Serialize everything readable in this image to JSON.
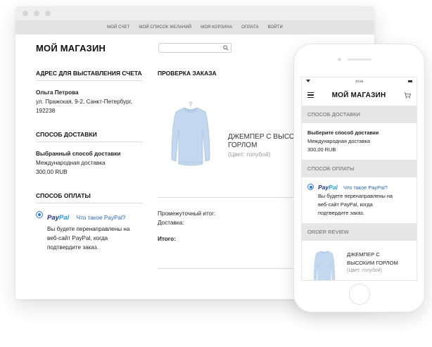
{
  "desktop": {
    "nav": [
      "МОЙ СЧЕТ",
      "МОЙ СПИСОК ЖЕЛАНИЙ",
      "МОЯ КОРЗИНА",
      "ОПЛАТА",
      "ВОЙТИ"
    ],
    "store_title": "МОЙ МАГАЗИН",
    "search": {
      "placeholder": ""
    },
    "billing": {
      "heading": "АДРЕС ДЛЯ ВЫСТАВЛЕНИЯ СЧЕТА",
      "name": "Ольга Петрова",
      "line1": "ул. Пражская, 9-2, Санкт-Петербург,",
      "line2": "192238"
    },
    "shipping": {
      "heading": "СПОСОБ ДОСТАВКИ",
      "label": "Выбранный способ доставки",
      "method": "Международная доставка",
      "price": "300,00 RUB"
    },
    "payment": {
      "heading": "СПОСОБ ОПЛАТЫ",
      "logo_part1": "Pay",
      "logo_part2": "Pal",
      "link": "Что такое PayPal?",
      "desc1": "Вы будете перенаправлены на",
      "desc2": "веб-сайт PayPal, когда",
      "desc3": "подтвердите заказ."
    },
    "review": {
      "heading": "ПРОВЕРКА ЗАКАЗА",
      "product_line1": "ДЖЕМПЕР С ВЫСОКИМ",
      "product_line2": "ГОРЛОМ",
      "product_color": "(Цвет: голубой)",
      "subtotal_label": "Промежуточный итог:",
      "delivery_label": "Доставка:",
      "total_label": "Итого:"
    }
  },
  "mobile": {
    "time": "10:26",
    "title": "МОЙ МАГАЗИН",
    "shipping": {
      "heading": "СПОСОБ ДОСТАВКИ",
      "label": "Выберите способ доставки",
      "method": "Международная доставка",
      "price": "300,00 RUB"
    },
    "payment": {
      "heading": "СПОСОБ ОПЛАТЫ",
      "logo_part1": "Pay",
      "logo_part2": "Pal",
      "link": "Что такое PayPal?",
      "desc1": "Вы будете перенаправлены на",
      "desc2": "веб-сайт PayPal, когда",
      "desc3": "подтвердите заказ."
    },
    "review": {
      "heading": "ORDER REVIEW",
      "product_line1": "ДЖЕМПЕР С",
      "product_line2": "ВЫСОКИМ ГОРЛОМ",
      "product_color": "(Цвет: голубой)"
    }
  },
  "colors": {
    "accent": "#2b7bd1",
    "paypal_dark": "#17337b",
    "paypal_light": "#1f9bde",
    "link": "#2a67b8",
    "section_bg": "#e6e6e6"
  }
}
